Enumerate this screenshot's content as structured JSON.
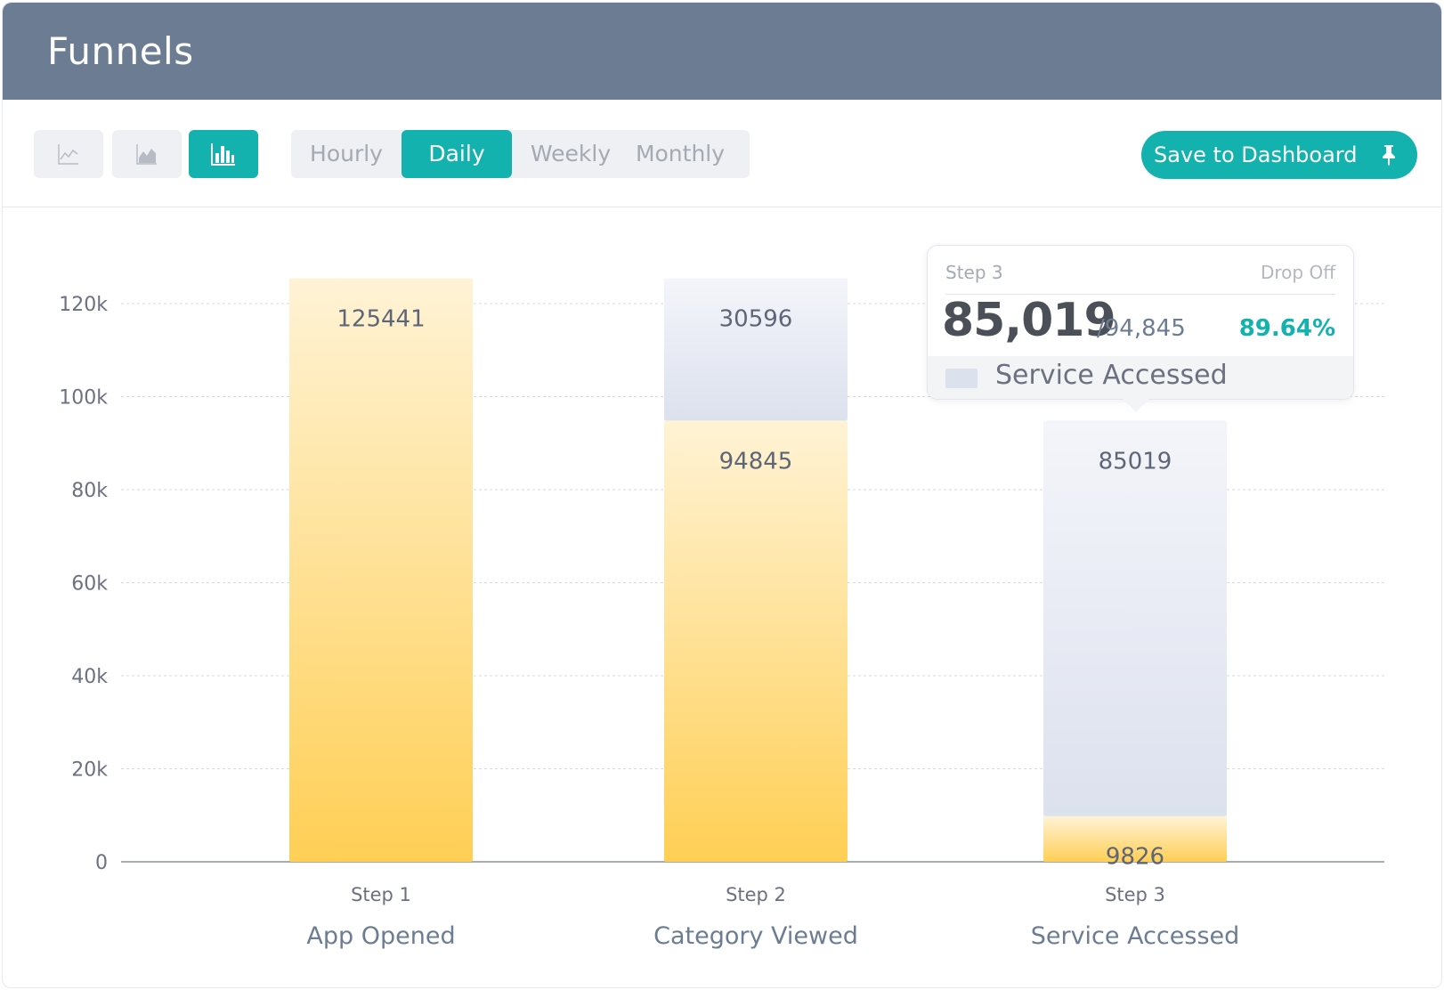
{
  "header": {
    "title": "Funnels"
  },
  "toolbar": {
    "chart_types": [
      {
        "name": "line-chart-icon",
        "active": false
      },
      {
        "name": "area-chart-icon",
        "active": false
      },
      {
        "name": "bar-chart-icon",
        "active": true
      }
    ],
    "granularity": {
      "options": [
        "Hourly",
        "Daily",
        "Weekly",
        "Monthly"
      ],
      "selected": "Daily"
    },
    "save_label": "Save to Dashboard",
    "save_icon": "pin-icon"
  },
  "colors": {
    "header_bg": "#6c7c92",
    "accent": "#14b2ae",
    "converted_top": "#fff3d6",
    "converted_bottom": "#ffcf55",
    "dropoff_top": "#f4f5fa",
    "dropoff_bottom": "#dce1ee"
  },
  "tooltip": {
    "step": "Step 3",
    "drop_off_label": "Drop Off",
    "value": "85,019",
    "total": "/94,845",
    "percent": "89.64%",
    "series": "Service Accessed"
  },
  "chart_data": {
    "type": "bar",
    "stacked": true,
    "categories": [
      "Step 1",
      "Step 2",
      "Step 3"
    ],
    "category_names": [
      "App Opened",
      "Category Viewed",
      "Service Accessed"
    ],
    "series": [
      {
        "values": [
          125441,
          94845,
          9826
        ]
      },
      {
        "values": [
          0,
          30596,
          85019
        ]
      }
    ],
    "y_ticks": [
      0,
      20000,
      40000,
      60000,
      80000,
      100000,
      120000
    ],
    "y_tick_labels": [
      "0",
      "20k",
      "40k",
      "60k",
      "80k",
      "100k",
      "120k"
    ],
    "ylim": [
      0,
      120000
    ],
    "grid": true
  }
}
